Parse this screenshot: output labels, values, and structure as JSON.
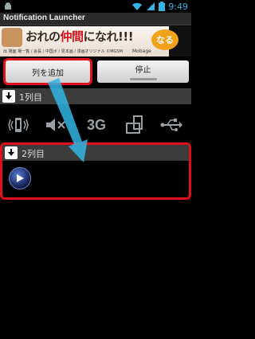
{
  "status_bar": {
    "time": "9:49",
    "icons": [
      "android-icon",
      "wifi-icon",
      "signal-icon",
      "battery-icon"
    ]
  },
  "app": {
    "title": "Notification Launcher"
  },
  "ad": {
    "headline_part1": "おれの",
    "headline_part2": "仲間",
    "headline_part3": "になれ!!!",
    "badge": "なる",
    "small_print": "出 場面 場一覧 / 会長 / 中国ボ / 見本画 / 漫画オリジナル ©MGSM",
    "brand": "Mobage"
  },
  "buttons": {
    "add_column": "列を追加",
    "stop": "停止"
  },
  "sections": {
    "col1": "1列目",
    "col2": "2列目"
  },
  "icon_row": {
    "network_3g": "3G",
    "icons": [
      "vibrate-icon",
      "mute-icon",
      "3g-icon",
      "rotate-icon",
      "usb-icon"
    ]
  },
  "colors": {
    "highlight": "#e0101a",
    "arrow": "#33b5e5",
    "status_accent": "#33b5e5"
  }
}
